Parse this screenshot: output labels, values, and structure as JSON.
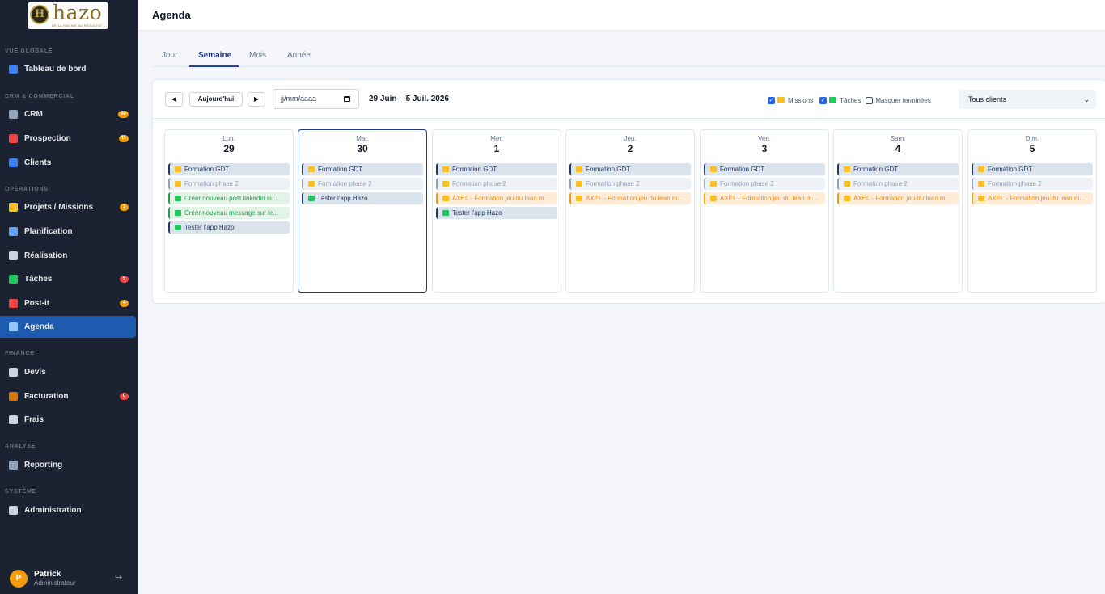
{
  "brand": {
    "word": "hazo",
    "mark": "H",
    "tagline": "DE LA RACINE AU RÉSULTAT"
  },
  "sidebar": {
    "sections": [
      {
        "title": "VUE GLOBALE",
        "items": [
          {
            "label": "Tableau de bord",
            "icon": "dashboard-icon",
            "color": "#3b82f6"
          }
        ]
      },
      {
        "title": "CRM & COMMERCIAL",
        "items": [
          {
            "label": "CRM",
            "icon": "building-icon",
            "color": "#94a3b8",
            "badge": "40",
            "badge_color": "#f59e0b"
          },
          {
            "label": "Prospection",
            "icon": "target-icon",
            "color": "#ef4444",
            "badge": "11",
            "badge_color": "#f59e0b"
          },
          {
            "label": "Clients",
            "icon": "users-icon",
            "color": "#3b82f6"
          }
        ]
      },
      {
        "title": "OPÉRATIONS",
        "items": [
          {
            "label": "Projets / Missions",
            "icon": "folder-icon",
            "color": "#fbbf24",
            "badge": "1",
            "badge_color": "#f59e0b"
          },
          {
            "label": "Planification",
            "icon": "calendar-icon",
            "color": "#60a5fa"
          },
          {
            "label": "Réalisation",
            "icon": "stopwatch-icon",
            "color": "#cbd5e1"
          },
          {
            "label": "Tâches",
            "icon": "checkbox-icon",
            "color": "#22c55e",
            "badge": "5",
            "badge_color": "#ef4444"
          },
          {
            "label": "Post-it",
            "icon": "pushpin-icon",
            "color": "#ef4444",
            "badge": "4",
            "badge_color": "#f59e0b"
          },
          {
            "label": "Agenda",
            "icon": "calendar-icon",
            "color": "#93c5fd",
            "active": true
          }
        ]
      },
      {
        "title": "FINANCE",
        "items": [
          {
            "label": "Devis",
            "icon": "document-icon",
            "color": "#cbd5e1"
          },
          {
            "label": "Facturation",
            "icon": "money-bag-icon",
            "color": "#d97706",
            "badge": "0",
            "badge_color": "#ef4444"
          },
          {
            "label": "Frais",
            "icon": "receipt-icon",
            "color": "#cbd5e1"
          }
        ]
      },
      {
        "title": "ANALYSE",
        "items": [
          {
            "label": "Reporting",
            "icon": "chart-icon",
            "color": "#94a3b8"
          }
        ]
      },
      {
        "title": "SYSTÈME",
        "items": [
          {
            "label": "Administration",
            "icon": "gear-icon",
            "color": "#cbd5e1"
          }
        ]
      }
    ]
  },
  "user": {
    "initial": "P",
    "name": "Patrick",
    "role": "Administrateur",
    "logout_glyph": "↪"
  },
  "header": {
    "title": "Agenda"
  },
  "tabs": [
    {
      "label": "Jour"
    },
    {
      "label": "Semaine",
      "active": true
    },
    {
      "label": "Mois"
    },
    {
      "label": "Année"
    }
  ],
  "toolbar": {
    "prev": "◀",
    "today": "Aujourd'hui",
    "next": "▶",
    "date_placeholder": "jj/mm/aaaa",
    "range": "29 Juin – 5 Juil. 2026",
    "filters": {
      "missions": "Missions",
      "taches": "Tâches",
      "masquer": "Masquer terminées"
    },
    "client_select": "Tous clients"
  },
  "week": [
    {
      "name": "Lun.",
      "num": "29",
      "events": [
        {
          "type": "mission",
          "text": "Formation GDT"
        },
        {
          "type": "phase",
          "text": "Formation phase 2"
        },
        {
          "type": "task",
          "text": "Créer nouveau post linkedin su..."
        },
        {
          "type": "task",
          "text": "Créer nouveau message sur le..."
        },
        {
          "type": "task-dark",
          "text": "Tester l'app Hazo"
        }
      ]
    },
    {
      "name": "Mar.",
      "num": "30",
      "today": true,
      "events": [
        {
          "type": "mission",
          "text": "Formation GDT"
        },
        {
          "type": "phase",
          "text": "Formation phase 2"
        },
        {
          "type": "task-dark",
          "text": "Tester l'app Hazo"
        }
      ]
    },
    {
      "name": "Mer.",
      "num": "1",
      "events": [
        {
          "type": "mission",
          "text": "Formation GDT"
        },
        {
          "type": "phase",
          "text": "Formation phase 2"
        },
        {
          "type": "axel",
          "text": "AXEL - Formation jeu du lean m..."
        },
        {
          "type": "task-dark",
          "text": "Tester l'app Hazo"
        }
      ]
    },
    {
      "name": "Jeu.",
      "num": "2",
      "events": [
        {
          "type": "mission",
          "text": "Formation GDT"
        },
        {
          "type": "phase",
          "text": "Formation phase 2"
        },
        {
          "type": "axel",
          "text": "AXEL - Formation jeu du lean m..."
        }
      ]
    },
    {
      "name": "Ven.",
      "num": "3",
      "events": [
        {
          "type": "mission",
          "text": "Formation GDT"
        },
        {
          "type": "phase",
          "text": "Formation phase 2"
        },
        {
          "type": "axel",
          "text": "AXEL - Formation jeu du lean m..."
        }
      ]
    },
    {
      "name": "Sam.",
      "num": "4",
      "events": [
        {
          "type": "mission",
          "text": "Formation GDT"
        },
        {
          "type": "phase",
          "text": "Formation phase 2"
        },
        {
          "type": "axel",
          "text": "AXEL - Formation jeu du lean m..."
        }
      ]
    },
    {
      "name": "Dim.",
      "num": "5",
      "events": [
        {
          "type": "mission",
          "text": "Formation GDT"
        },
        {
          "type": "phase",
          "text": "Formation phase 2"
        },
        {
          "type": "axel",
          "text": "AXEL - Formation jeu du lean m..."
        }
      ]
    }
  ]
}
